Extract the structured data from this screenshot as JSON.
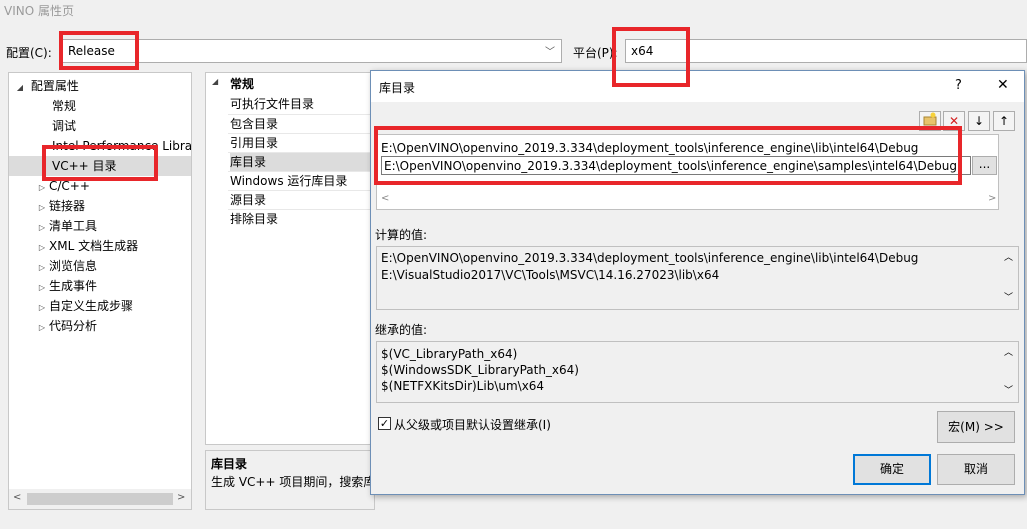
{
  "window": {
    "title": "VINO 属性页"
  },
  "top": {
    "config_label": "配置(C):",
    "config_value": "Release",
    "platform_label": "平台(P):",
    "platform_value": "x64"
  },
  "tree": {
    "root": "配置属性",
    "items": [
      "常规",
      "调试",
      "Intel Performance Librar",
      "VC++ 目录"
    ],
    "groups": [
      "C/C++",
      "链接器",
      "清单工具",
      "XML 文档生成器",
      "浏览信息",
      "生成事件",
      "自定义生成步骤",
      "代码分析"
    ]
  },
  "props": {
    "header": "常规",
    "items": [
      "可执行文件目录",
      "包含目录",
      "引用目录",
      "库目录",
      "Windows 运行库目录",
      "源目录",
      "排除目录"
    ],
    "desc_title": "库目录",
    "desc_text": "生成 VC++ 项目期间，搜索库"
  },
  "dialog": {
    "title": "库目录",
    "help": "?",
    "close": "✕",
    "entries": [
      "E:\\OpenVINO\\openvino_2019.3.334\\deployment_tools\\inference_engine\\lib\\intel64\\Debug",
      "E:\\OpenVINO\\openvino_2019.3.334\\deployment_tools\\inference_engine\\samples\\intel64\\Debug"
    ],
    "browse": "...",
    "computed_label": "计算的值:",
    "computed": [
      "E:\\OpenVINO\\openvino_2019.3.334\\deployment_tools\\inference_engine\\lib\\intel64\\Debug",
      "E:\\VisualStudio2017\\VC\\Tools\\MSVC\\14.16.27023\\lib\\x64"
    ],
    "inherited_label": "继承的值:",
    "inherited": [
      "$(VC_LibraryPath_x64)",
      "$(WindowsSDK_LibraryPath_x64)",
      "$(NETFXKitsDir)Lib\\um\\x64"
    ],
    "inherit_check": "从父级或项目默认设置继承(I)",
    "macro": "宏(M) >>",
    "ok": "确定",
    "cancel": "取消"
  },
  "colors": {
    "highlight": "#e8262a",
    "selection": "#dcdcdc",
    "focus": "#0078d7"
  }
}
